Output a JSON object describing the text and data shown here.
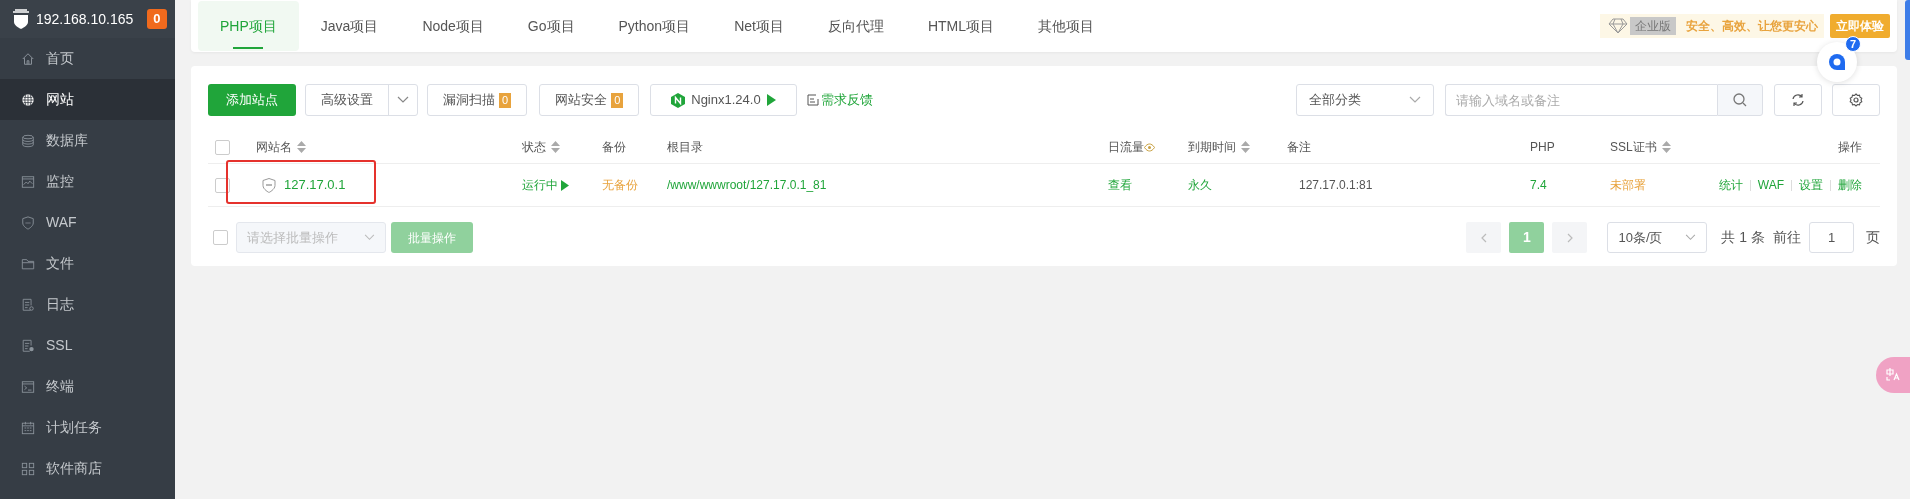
{
  "sidebar": {
    "host": "192.168.10.165",
    "badge": "0",
    "items": [
      {
        "label": "首页",
        "selected": false
      },
      {
        "label": "网站",
        "selected": true
      },
      {
        "label": "数据库",
        "selected": false
      },
      {
        "label": "监控",
        "selected": false
      },
      {
        "label": "WAF",
        "selected": false
      },
      {
        "label": "文件",
        "selected": false
      },
      {
        "label": "日志",
        "selected": false
      },
      {
        "label": "SSL",
        "selected": false
      },
      {
        "label": "终端",
        "selected": false
      },
      {
        "label": "计划任务",
        "selected": false
      },
      {
        "label": "软件商店",
        "selected": false
      }
    ]
  },
  "tabs": [
    {
      "label": "PHP项目",
      "selected": true
    },
    {
      "label": "Java项目",
      "selected": false
    },
    {
      "label": "Node项目",
      "selected": false
    },
    {
      "label": "Go项目",
      "selected": false
    },
    {
      "label": "Python项目",
      "selected": false
    },
    {
      "label": "Net项目",
      "selected": false
    },
    {
      "label": "反向代理",
      "selected": false
    },
    {
      "label": "HTML项目",
      "selected": false
    },
    {
      "label": "其他项目",
      "selected": false
    }
  ],
  "promo": {
    "edition": "企业版",
    "slogan": "安全、高效、让您更安心",
    "button": "立即体验"
  },
  "chat_badge": "7",
  "toolbar": {
    "add": "添加站点",
    "advanced": "高级设置",
    "scan": "漏洞扫描",
    "scan_count": "0",
    "security": "网站安全",
    "security_count": "0",
    "nginx": "Nginx1.24.0",
    "feedback": "需求反馈",
    "category": "全部分类",
    "search": {
      "placeholder": "请输入域名或备注"
    }
  },
  "table": {
    "select_all": {
      "checked": false
    },
    "columns": [
      {
        "label": "网站名",
        "kind": "sortable"
      },
      {
        "label": "状态",
        "kind": "sortable"
      },
      {
        "label": "备份",
        "kind": "plain"
      },
      {
        "label": "根目录",
        "kind": "plain"
      },
      {
        "label": "日流量",
        "kind": "info"
      },
      {
        "label": "到期时间",
        "kind": "sortable"
      },
      {
        "label": "备注",
        "kind": "plain"
      },
      {
        "label": "PHP",
        "kind": "plain"
      },
      {
        "label": "SSL证书",
        "kind": "sortable"
      },
      {
        "label": "操作",
        "kind": "plain"
      }
    ],
    "rows": [
      {
        "checked": false,
        "name": "127.17.0.1",
        "status": "运行中",
        "running": true,
        "backup": "无备份",
        "root": "/www/wwwroot/127.17.0.1_81",
        "traffic": "查看",
        "expiry": "永久",
        "note": "127.17.0.1:81",
        "php": "7.4",
        "ssl": "未部署",
        "actions": [
          "统计",
          "WAF",
          "设置",
          "删除"
        ]
      }
    ]
  },
  "footer": {
    "select_all": {
      "checked": false
    },
    "batch": {
      "placeholder": "请选择批量操作"
    },
    "batch_button": "批量操作",
    "pages": [
      {
        "label": "1",
        "selected": true
      }
    ],
    "page_size": "10条/页",
    "total": "共 1 条",
    "goto": "前往",
    "goto_value": "1",
    "page_unit": "页"
  }
}
